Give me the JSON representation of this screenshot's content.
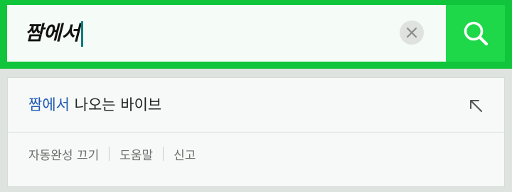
{
  "search": {
    "query": "짬에서",
    "clear_icon": "close-icon",
    "search_icon": "search-icon"
  },
  "suggestions": [
    {
      "match": "짬에서",
      "rest": " 나오는 바이브",
      "action_icon": "arrow-up-left-icon"
    }
  ],
  "footer": {
    "autocomplete_off": "자동완성 끄기",
    "help": "도움말",
    "report": "신고"
  },
  "colors": {
    "brand_green": "#10c53c",
    "search_button_green": "#1ed84a",
    "highlight_blue": "#1f5ab5",
    "caret": "#087d7c"
  }
}
